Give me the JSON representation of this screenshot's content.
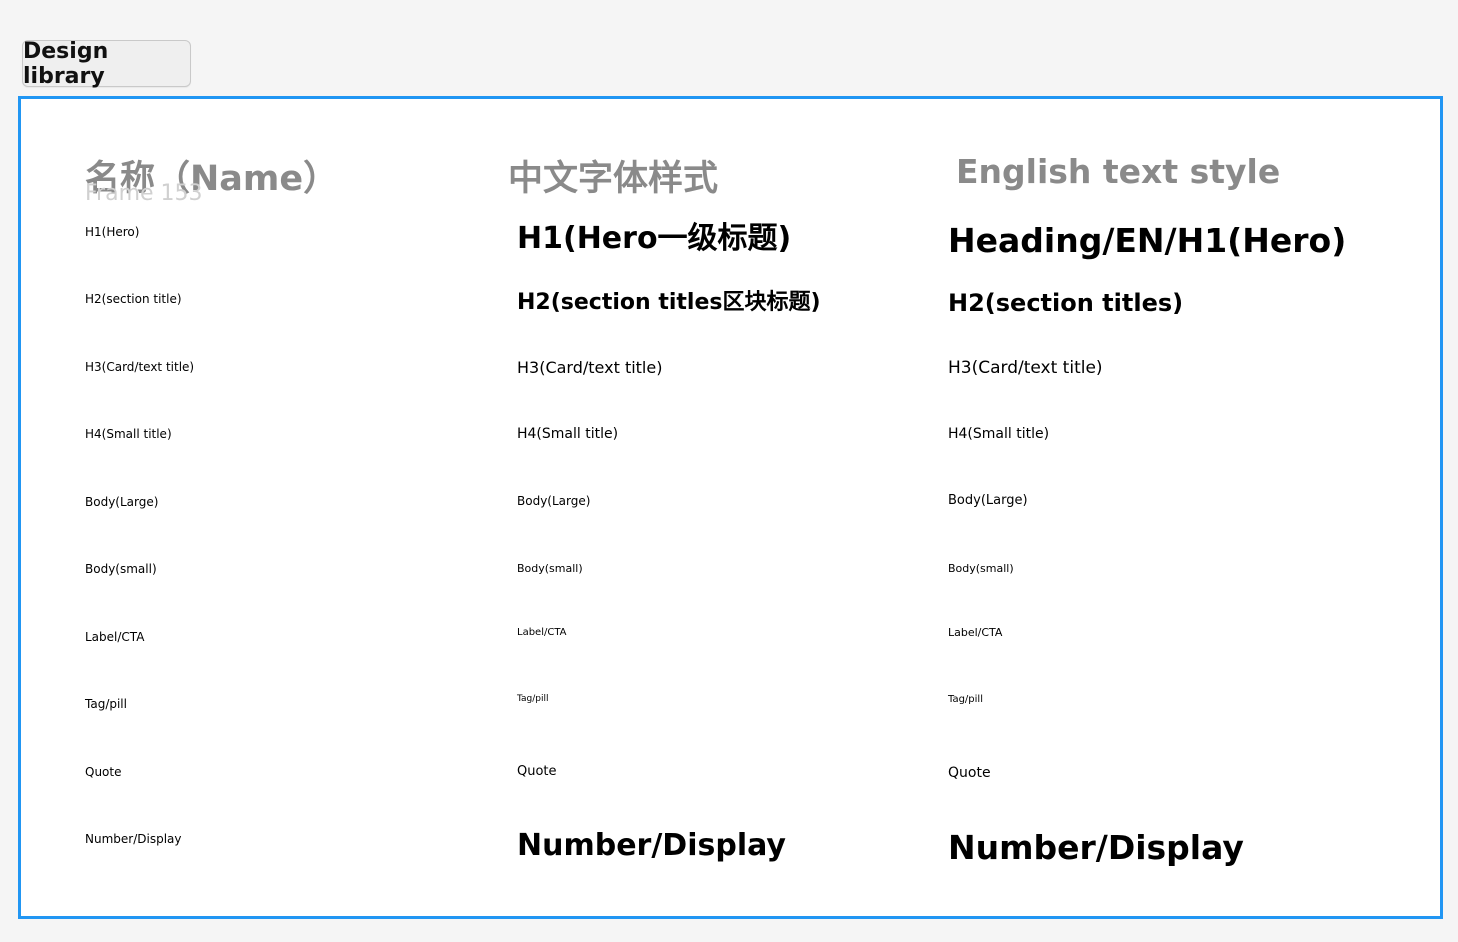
{
  "toolbar": {
    "design_library_label": "Design library"
  },
  "frame": {
    "label": "Frame 153"
  },
  "columns": {
    "name_header": "名称（Name）",
    "chinese_header": "中文字体样式",
    "english_header": "English text style"
  },
  "rows": [
    {
      "name": "H1(Hero)",
      "cn": "H1(Hero一级标题)",
      "en": "Heading/EN/H1(Hero)"
    },
    {
      "name": "H2(section title)",
      "cn": "H2(section titles区块标题)",
      "en": "H2(section titles)"
    },
    {
      "name": "H3(Card/text title)",
      "cn": "H3(Card/text title)",
      "en": "H3(Card/text title)"
    },
    {
      "name": "H4(Small title)",
      "cn": "H4(Small title)",
      "en": "H4(Small title)"
    },
    {
      "name": "Body(Large)",
      "cn": "Body(Large)",
      "en": "Body(Large)"
    },
    {
      "name": "Body(small)",
      "cn": "Body(small)",
      "en": "Body(small)"
    },
    {
      "name": "Label/CTA",
      "cn": "Label/CTA",
      "en": "Label/CTA"
    },
    {
      "name": "Tag/pill",
      "cn": "Tag/pill",
      "en": "Tag/pill"
    },
    {
      "name": "Quote",
      "cn": "Quote",
      "en": "Quote"
    },
    {
      "name": "Number/Display",
      "cn": "Number/Display",
      "en": "Number/Display"
    }
  ],
  "colors": {
    "frame_border": "#2196f3",
    "header_gray": "#8a8a8a",
    "frame_label_gray": "#d0d0d0"
  }
}
